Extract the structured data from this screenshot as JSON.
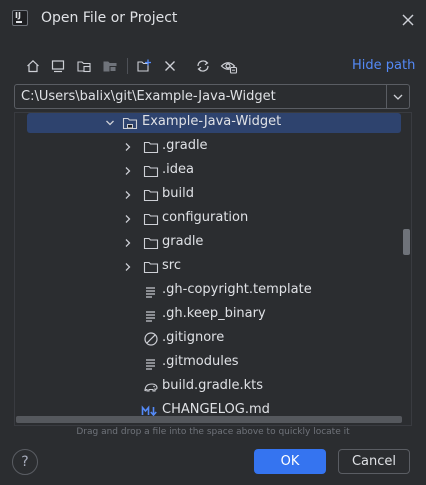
{
  "window": {
    "title": "Open File or Project",
    "logo_text": "IJ"
  },
  "toolbar": {
    "icons": [
      "home-icon",
      "desktop-icon",
      "project-directory-icon",
      "module-directory-icon",
      "new-folder-icon",
      "delete-icon",
      "refresh-icon",
      "show-hidden-icon"
    ],
    "hide_path_label": "Hide path"
  },
  "path": {
    "value": "C:\\Users\\balix\\git\\Example-Java-Widget"
  },
  "tree": {
    "items": [
      {
        "label": "Example-Java-Widget",
        "kind": "project-folder",
        "expanded": true,
        "selected": true
      },
      {
        "label": ".gradle",
        "kind": "folder",
        "expanded": false
      },
      {
        "label": ".idea",
        "kind": "folder",
        "expanded": false
      },
      {
        "label": "build",
        "kind": "folder",
        "expanded": false
      },
      {
        "label": "configuration",
        "kind": "folder",
        "expanded": false
      },
      {
        "label": "gradle",
        "kind": "folder",
        "expanded": false
      },
      {
        "label": "src",
        "kind": "folder",
        "expanded": false
      },
      {
        "label": ".gh-copyright.template",
        "kind": "text-file"
      },
      {
        "label": ".gh.keep_binary",
        "kind": "text-file"
      },
      {
        "label": ".gitignore",
        "kind": "ignore-file"
      },
      {
        "label": ".gitmodules",
        "kind": "text-file"
      },
      {
        "label": "build.gradle.kts",
        "kind": "gradle-file"
      },
      {
        "label": "CHANGELOG.md",
        "kind": "markdown-file"
      }
    ]
  },
  "hint": "Drag and drop a file into the space above to quickly locate it",
  "buttons": {
    "help": "?",
    "ok": "OK",
    "cancel": "Cancel"
  },
  "colors": {
    "background": "#2b2d30",
    "accent": "#3574f0",
    "link": "#548af7",
    "selection": "#2e436e"
  }
}
